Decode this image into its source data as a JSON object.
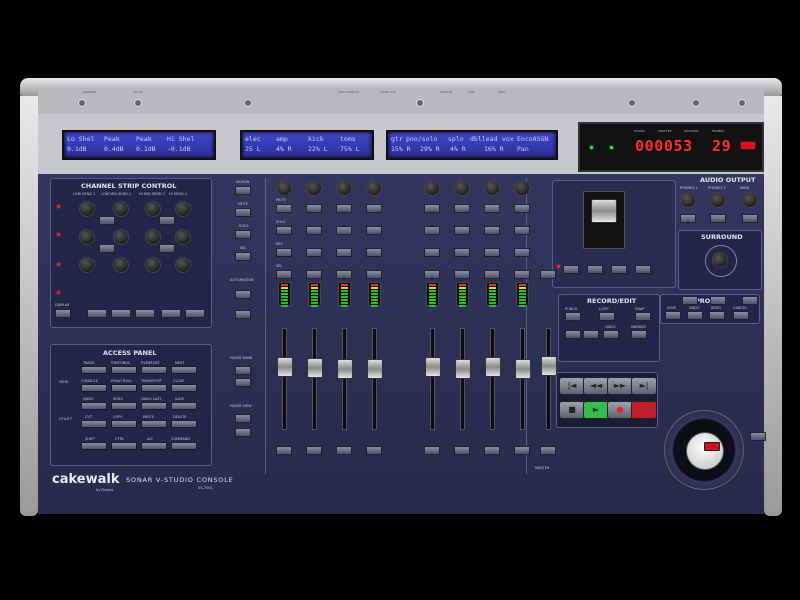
{
  "top_bar": {
    "port_labels": [
      "◄ POWER",
      "DC IN",
      "FOOT SWITCH",
      "S/PDIF 1/2",
      "OPTICAL",
      "USB",
      "MIDI"
    ]
  },
  "lcd": {
    "row1": [
      "Lo Shel",
      "Peak",
      "Peak",
      "Hi Shel",
      "elec",
      "amp",
      "kick",
      "toms",
      "gtr",
      "pno/solo",
      "splo",
      "dbllead",
      "vox",
      "EncoASGN"
    ],
    "row2": [
      "0.1dB",
      "0.4dB",
      "0.1dB",
      "-0.1dB",
      "25 L",
      "4% R",
      "22% L",
      "75% L",
      "15% R",
      "29% R",
      "4% R",
      "16% R",
      "Pan"
    ]
  },
  "timecode": {
    "digits": "000053",
    "frames": "29",
    "labels": [
      "HOURS",
      "MINUTES",
      "SECONDS",
      "FRAMES"
    ]
  },
  "channel_strip": {
    "title": "CHANNEL STRIP CONTROL",
    "sends": [
      "LOW SEND 1",
      "LOW MID SEND 2",
      "HI MID SEND 3",
      "HI SEND 4"
    ],
    "display_label": "DISPLAY"
  },
  "access_panel": {
    "title": "ACCESS PANEL",
    "row_labels": [
      "VIEW",
      "UTILITY"
    ],
    "buttons": [
      [
        "TRACK",
        "STAFF/BUS",
        "EVENTLIST",
        "NEXT"
      ],
      [
        "CONSOLE",
        "PIANO ROLL",
        "TRANSPORT",
        "CLOSE"
      ],
      [
        "UNDO",
        "REDO",
        "UNDO LAST",
        "SAVE"
      ],
      [
        "CUT",
        "COPY",
        "PASTE",
        "DELETE"
      ],
      [
        "SHIFT",
        "CTRL",
        "ALT",
        "COMMAND"
      ]
    ]
  },
  "left_column": {
    "labels": [
      "ASSIGN",
      "MUTE",
      "SOLO",
      "SEL",
      "AUTOMATION",
      "FADER BANK",
      "FADER VIEW"
    ]
  },
  "mixer": {
    "row_labels": [
      "MUTE",
      "SOLO",
      "REC",
      "SEL"
    ],
    "channel_count": 9,
    "master_label": "MASTER",
    "fader_levels": [
      0.62,
      0.61,
      0.6,
      0.6,
      0.62,
      0.6,
      0.62,
      0.6,
      0.63
    ]
  },
  "record_edit": {
    "title": "RECORD/EDIT",
    "buttons": [
      "PUNCH",
      "LOOP",
      "SNAP",
      "UNDO",
      "MARKER"
    ]
  },
  "project": {
    "title": "PROJECT",
    "buttons": [
      "SAVE",
      "UNDO",
      "REDO",
      "CANCEL"
    ]
  },
  "transport": {
    "rewind_icon": "◄◄",
    "ffwd_icon": "►►",
    "stop_icon": "■",
    "play_icon": "►",
    "record_icon": "●",
    "start_icon": "|◄",
    "end_icon": "►|"
  },
  "audio_output": {
    "title": "AUDIO OUTPUT",
    "labels": [
      "PHONES 1",
      "PHONES 2",
      "MAIN"
    ]
  },
  "surround": {
    "title": "SURROUND"
  },
  "brand": {
    "logo": "cakewalk",
    "sublogo": "by Roland",
    "model": "SONAR V-STUDIO CONSOLE",
    "model_code": "VS-700C"
  },
  "colors": {
    "panel": "#2f3257",
    "lcd": "#3a40c0",
    "led_red": "#ff2d2d",
    "play_green": "#2fbf4a"
  }
}
